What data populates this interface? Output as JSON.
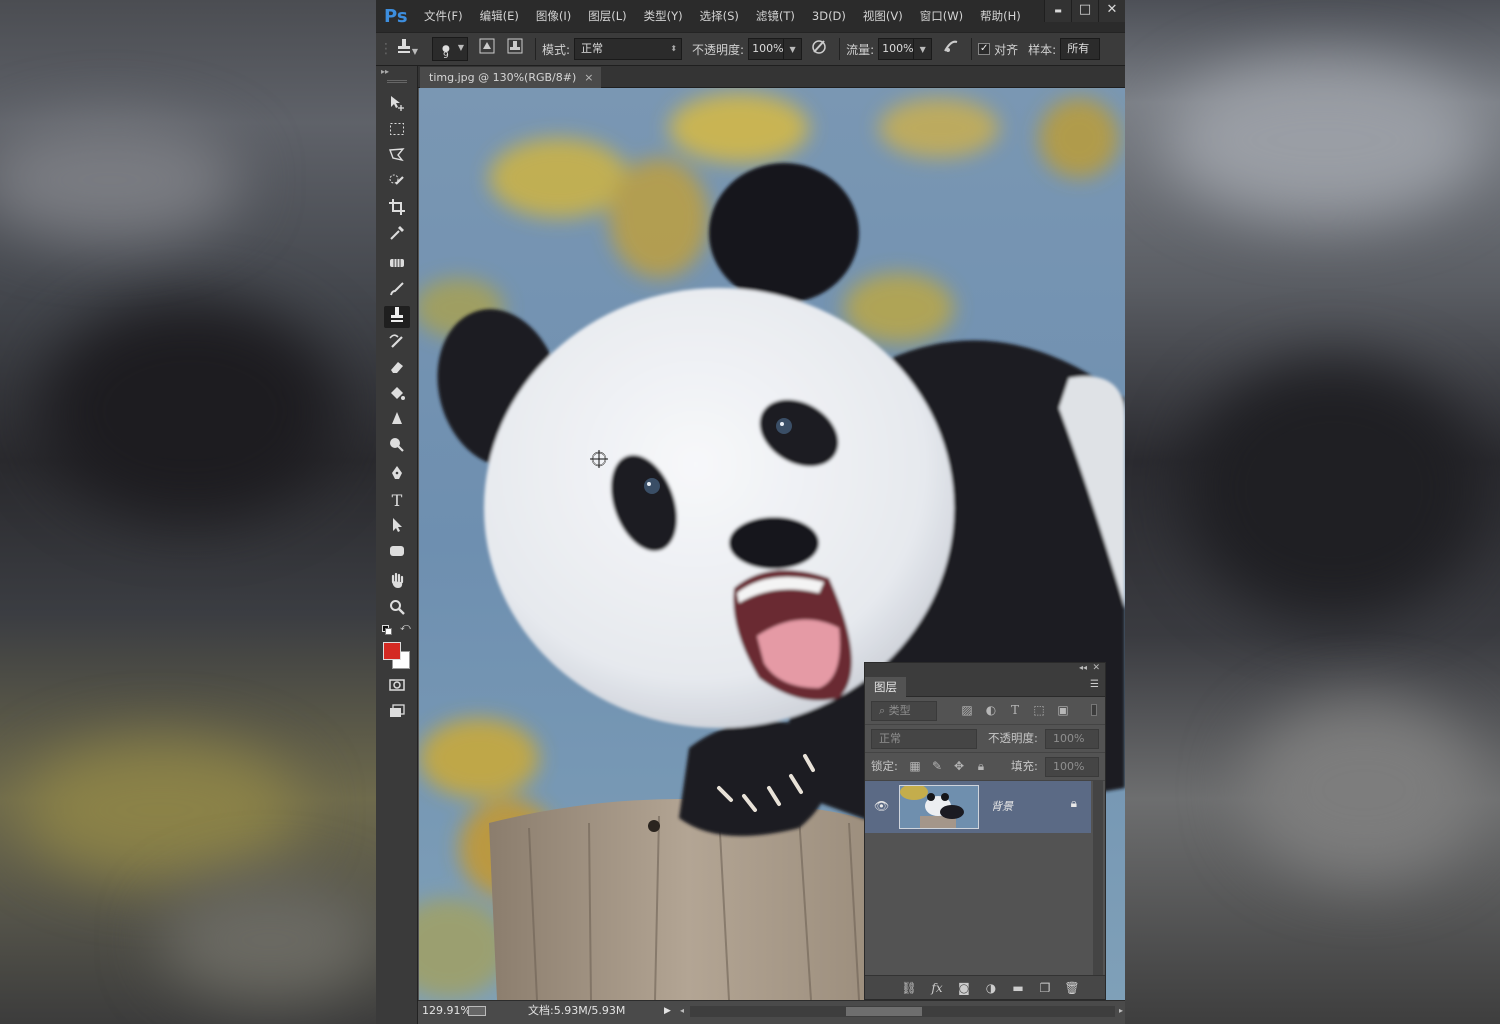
{
  "menubar": {
    "logo": "Ps",
    "items": [
      "文件(F)",
      "编辑(E)",
      "图像(I)",
      "图层(L)",
      "类型(Y)",
      "选择(S)",
      "滤镜(T)",
      "3D(D)",
      "视图(V)",
      "窗口(W)",
      "帮助(H)"
    ]
  },
  "window_controls": {
    "minimize": "▬",
    "maximize": "□",
    "close": "✕"
  },
  "options": {
    "brush_size": "9",
    "mode_label": "模式:",
    "mode_value": "正常",
    "opacity_label": "不透明度:",
    "opacity_value": "100%",
    "flow_label": "流量:",
    "flow_value": "100%",
    "align_label": "对齐",
    "sample_label": "样本:",
    "sample_value": "所有"
  },
  "document": {
    "tab_title": "timg.jpg @ 130%(RGB/8#)",
    "tab_close": "×",
    "zoom": "129.91%",
    "doc_size": "文档:5.93M/5.93M"
  },
  "toolbar": {
    "active_tool": "clone-stamp",
    "foreground_color": "#d42a23",
    "background_color": "#ffffff",
    "tools": [
      "move",
      "marquee",
      "lasso",
      "quick-select",
      "crop",
      "eyedropper",
      "healing",
      "brush",
      "clone-stamp",
      "history-brush",
      "eraser",
      "paint-bucket",
      "blur",
      "dodge",
      "pen",
      "type",
      "path-select",
      "shape",
      "hand",
      "zoom"
    ]
  },
  "layers_panel": {
    "tab_label": "图层",
    "filter_kind": "类型",
    "blend_mode": "正常",
    "opacity_label": "不透明度:",
    "opacity_value": "100%",
    "lock_label": "锁定:",
    "fill_label": "填充:",
    "fill_value": "100%",
    "layers": [
      {
        "name": "背景",
        "visible": true,
        "locked": true
      }
    ]
  },
  "colors": {
    "menubar": "#2b2b2b",
    "panel": "#535353",
    "selected_layer": "#5b6a85",
    "ps_blue": "#3d8ede"
  }
}
